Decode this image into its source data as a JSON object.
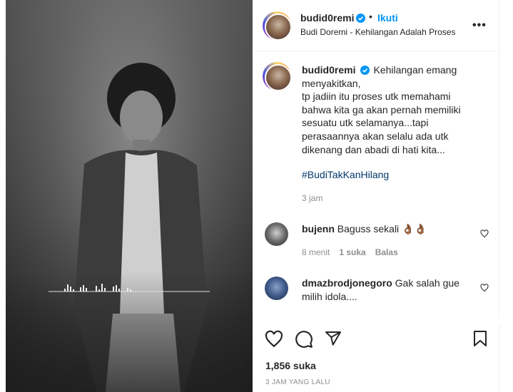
{
  "post": {
    "author": "budid0remi",
    "follow_label": "Ikuti",
    "dot": "•",
    "audio": "Budi Doremi - Kehilangan Adalah Proses",
    "more": "•••"
  },
  "caption": {
    "author": "budid0remi",
    "text": "Kehilangan emang menyakitkan,",
    "lines": [
      "tp jadiin itu proses utk memahami",
      "bahwa kita ga akan pernah memiliki",
      "sesuatu utk selamanya...tapi",
      "perasaannya akan selalu ada utk",
      "dikenang dan abadi di hati kita..."
    ],
    "hashtag": "#BudiTakKanHilang",
    "time": "3 jam"
  },
  "comments": [
    {
      "user": "bujenn",
      "text": "Baguss sekali 👌🏾👌🏾",
      "time": "8 menit",
      "likes": "1 suka",
      "reply": "Balas"
    },
    {
      "user": "dmazbrodjonegoro",
      "text": "Gak salah gue milih idola...."
    }
  ],
  "footer": {
    "likes": "1,856 suka",
    "ago": "3 JAM YANG LALU"
  },
  "colors": {
    "verified": "#0095f6",
    "link": "#0095f6",
    "hashtag": "#00376b",
    "muted": "#8e8e8e"
  },
  "icons": [
    "verified-badge-icon",
    "more-icon",
    "heart-icon",
    "comment-icon",
    "share-icon",
    "bookmark-icon",
    "heart-small-icon"
  ]
}
